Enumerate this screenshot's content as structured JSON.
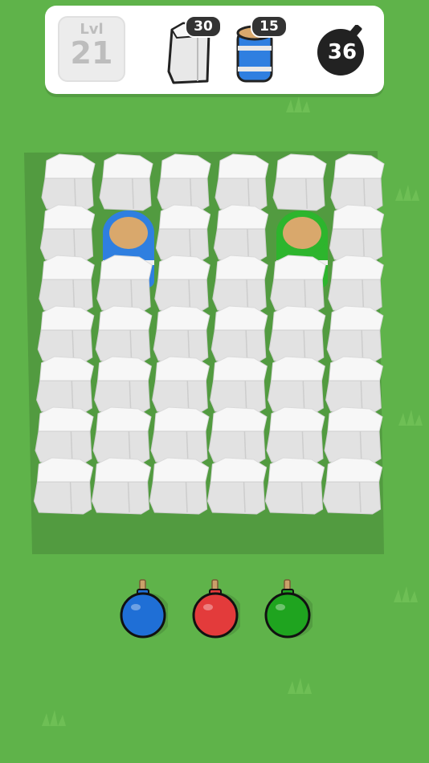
{
  "hud": {
    "level_label": "Lvl",
    "level_number": "21",
    "goals": [
      {
        "icon": "stone-block-icon",
        "count": "30"
      },
      {
        "icon": "blue-barrel-icon",
        "count": "15"
      }
    ],
    "bombs_remaining": "36"
  },
  "board": {
    "columns": 6,
    "rows": 7,
    "stone_color": "#e3e3e3",
    "barrels": [
      {
        "color": "blue",
        "hex": "#2f7fe0",
        "column": 2,
        "row": 2
      },
      {
        "color": "green",
        "hex": "#2db52d",
        "column": 5,
        "row": 2
      }
    ]
  },
  "bomb_tray": [
    {
      "color": "blue",
      "hex": "#1f6fd6"
    },
    {
      "color": "red",
      "hex": "#e33b3b"
    },
    {
      "color": "green",
      "hex": "#1fa41f"
    }
  ],
  "colors": {
    "grass": "#5fb34a",
    "hud_background": "#ffffff",
    "badge": "#333333"
  }
}
